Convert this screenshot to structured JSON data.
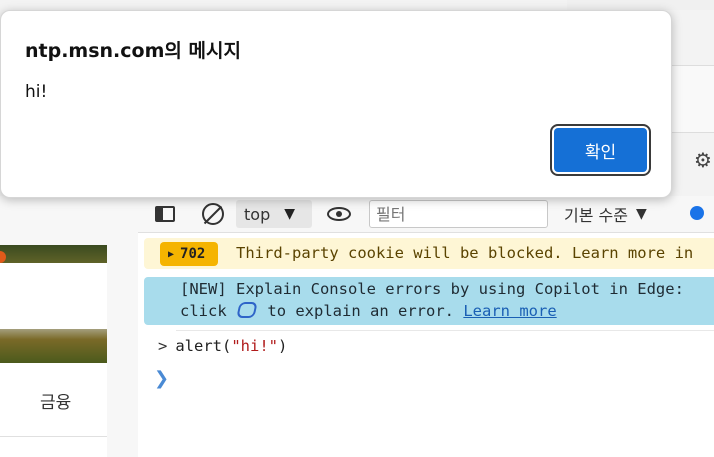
{
  "dialog": {
    "title": "ntp.msn.com의 메시지",
    "message": "hi!",
    "ok_label": "확인"
  },
  "left_page": {
    "tab_label": "금융"
  },
  "devtools": {
    "toolbar": {
      "context": "top",
      "filter_placeholder": "필터",
      "level": "기본 수준",
      "sidebar_icon": "sidebar-toggle-icon",
      "clear_icon": "clear-console-icon",
      "eye_icon": "live-expression-icon"
    },
    "console": {
      "warning_count": "702",
      "warning_text": "Third-party cookie will be blocked. Learn more in",
      "info_line1": "[NEW] Explain Console errors by using Copilot in Edge:",
      "info_line2_pre": "click",
      "info_line2_mid": "to explain an error.",
      "info_link": "Learn more",
      "command_prefix": "alert(",
      "command_arg": "\"hi!\"",
      "command_suffix": ")",
      "prompt_symbol": "❯"
    }
  },
  "colors": {
    "warning_bg": "#fef6d5",
    "warning_badge": "#f5b400",
    "info_bg": "#a8dcec",
    "ok_button": "#1570d6"
  }
}
